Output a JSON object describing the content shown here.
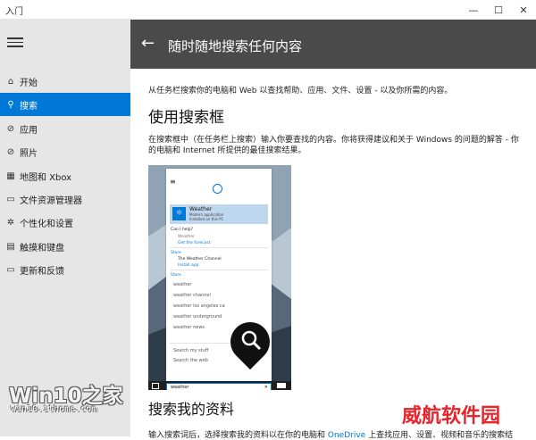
{
  "window": {
    "title": "入门",
    "minimize": "—",
    "maximize": "☐",
    "close": "✕"
  },
  "sidebar": {
    "items": [
      {
        "label": "开始",
        "icon": "home-icon",
        "glyph": "⌂"
      },
      {
        "label": "搜索",
        "icon": "search-icon",
        "glyph": "⚲",
        "active": true
      },
      {
        "label": "应用",
        "icon": "apps-icon",
        "glyph": "⊘"
      },
      {
        "label": "照片",
        "icon": "photos-icon",
        "glyph": "⊘"
      },
      {
        "label": "地图和 Xbox",
        "icon": "grid-icon",
        "glyph": "▦"
      },
      {
        "label": "文件资源管理器",
        "icon": "folder-icon",
        "glyph": "▭"
      },
      {
        "label": "个性化和设置",
        "icon": "gear-icon",
        "glyph": "✲"
      },
      {
        "label": "触摸和键盘",
        "icon": "keyboard-icon",
        "glyph": "▤"
      },
      {
        "label": "更新和反馈",
        "icon": "feedback-icon",
        "glyph": "▭"
      }
    ]
  },
  "header": {
    "back": "←",
    "title": "随时随地搜索任何内容"
  },
  "content": {
    "intro": "从任务栏搜索你的电脑和 Web 以查找帮助、应用、文件、设置 - 以及你所需的内容。",
    "section1_title": "使用搜索框",
    "section1_para": "在搜索框中（在任务栏上搜索）输入你要查找的内容。你将获得建议和关于 Windows 的问题的解答 - 你的电脑和 Internet 所提供的最佳搜索结果。",
    "section2_title": "搜索我的资料",
    "section2_para_a": "输入搜索词后，选择搜索我的资料以在你的电脑和 ",
    "section2_link": "OneDrive",
    "section2_para_b": " 上查找应用、设置、视频和音乐的搜索结"
  },
  "screenshot": {
    "weather_title": "Weather",
    "weather_sub1": "Modern application",
    "weather_sub2": "Installed on this PC",
    "can_help": "Can I help?",
    "weather2": "Weather",
    "get_forecast": "Get the forecast",
    "store1": "Store",
    "channel_app": "The Weather Channel",
    "install_app": "Install app",
    "store2": "Store",
    "suggestions": [
      "weather",
      "weather channel",
      "weather los angeles ca",
      "weather underground",
      "weather news"
    ],
    "search_my_stuff": "Search my stuff",
    "search_web": "Search the web",
    "query": "weather",
    "clear": "✕"
  },
  "watermarks": {
    "brand": "Win10之家",
    "url": "win10.ithome.com",
    "site": "威航软件园"
  }
}
